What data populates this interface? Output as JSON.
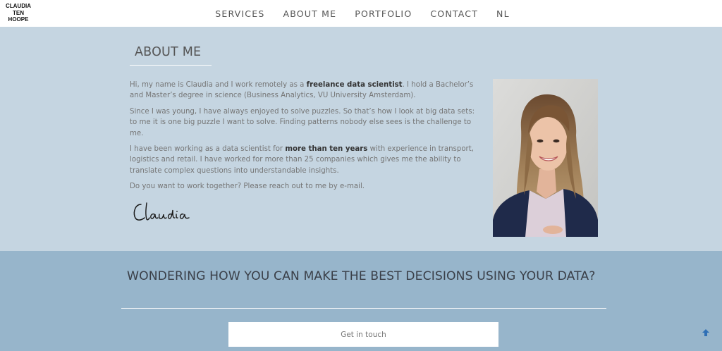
{
  "header": {
    "logo_lines": [
      "CLAUDIA",
      "TEN",
      "HOOPE"
    ],
    "nav": [
      "SERVICES",
      "ABOUT ME",
      "PORTFOLIO",
      "CONTACT",
      "NL"
    ]
  },
  "about": {
    "title": "ABOUT ME",
    "p1": {
      "a": "Hi, my name is Claudia and I work remotely as a ",
      "b": "freelance data scientist",
      "c": ". I hold a Bachelor’s and Master’s degree in science (Business Analytics, VU University Amsterdam)."
    },
    "p2": "Since I was young, I have always enjoyed to solve puzzles. So that’s how I look at big data sets: to me it is one big puzzle I want to solve. Finding patterns nobody else sees is the challenge to me.",
    "p3": {
      "a": "I have been working as a data scientist for ",
      "b": "more than ten years",
      "c": " with experience in transport, logistics and retail. I have worked for more than 25 companies which gives me the ability to translate complex questions into understandable insights."
    },
    "p4": "Do you want to work together? Please reach out to me by e-mail.",
    "signature_text": "Claudia"
  },
  "cta": {
    "heading": "WONDERING HOW YOU CAN MAKE THE BEST DECISIONS USING YOUR DATA?",
    "button": "Get in touch"
  },
  "colors": {
    "about_bg": "#c5d5e1",
    "cta_bg": "#97b5cb",
    "accent_arrow": "#2f6fb5"
  },
  "icons": {
    "back_to_top": "arrow-up-icon"
  }
}
